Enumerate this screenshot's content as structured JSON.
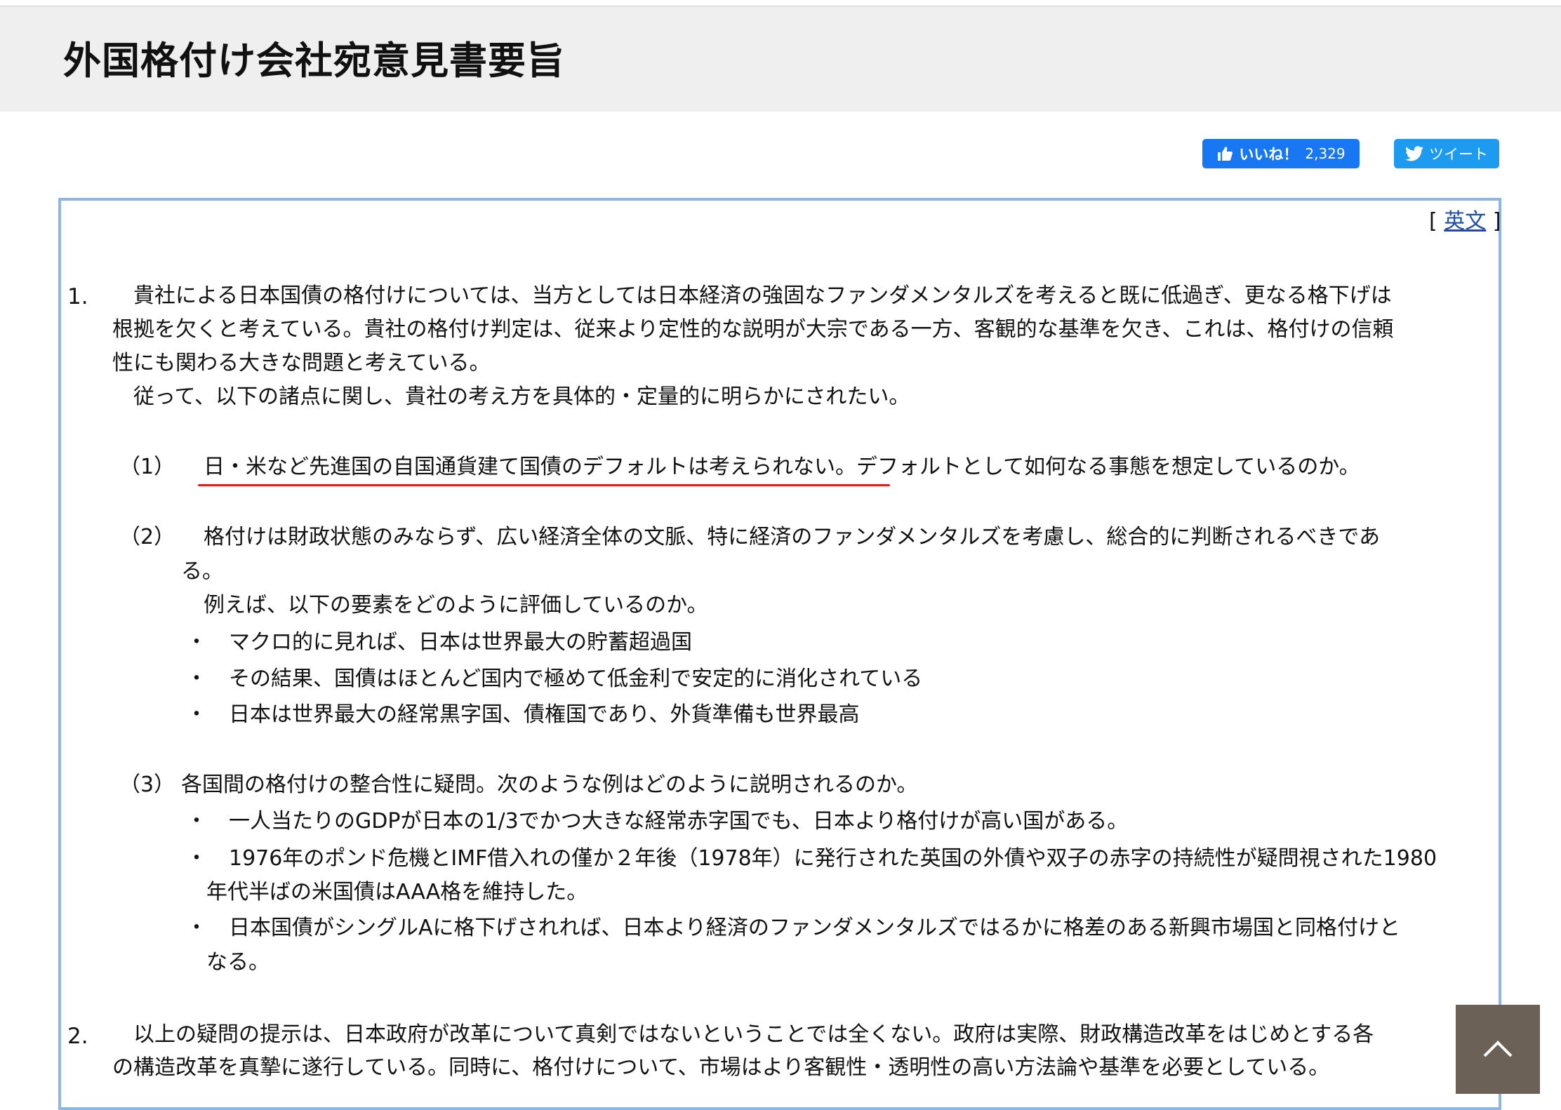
{
  "header": {
    "title": "外国格付け会社宛意見書要旨"
  },
  "social": {
    "like_label": "いいね！",
    "like_count": "2,329",
    "tweet_label": "ツイート"
  },
  "english_link": {
    "open": "[ ",
    "label": "英文",
    "close": " ]"
  },
  "section1": {
    "number": "1.",
    "lines": [
      "　貴社による日本国債の格付けについては、当方としては日本経済の強固なファンダメンタルズを考えると既に低過ぎ、更なる格下げは",
      "根拠を欠くと考えている。貴社の格付け判定は、従来より定性的な説明が大宗である一方、客観的な基準を欠き、これは、格付けの信頼",
      "性にも関わる大きな問題と考えている。",
      "　従って、以下の諸点に関し、貴社の考え方を具体的・定量的に明らかにされたい。"
    ]
  },
  "item1": {
    "marker": "（1）",
    "text": "日・米など先進国の自国通貨建て国債のデフォルトは考えられない。デフォルトとして如何なる事態を想定しているのか。"
  },
  "item2": {
    "marker": "（2）",
    "lines": [
      "格付けは財政状態のみならず、広い経済全体の文脈、特に経済のファンダメンタルズを考慮し、総合的に判断されるべきであ",
      "る。",
      "例えば、以下の要素をどのように評価しているのか。"
    ],
    "bullet": "・",
    "bullets": [
      "マクロ的に見れば、日本は世界最大の貯蓄超過国",
      "その結果、国債はほとんど国内で極めて低金利で安定的に消化されている",
      "日本は世界最大の経常黒字国、債権国であり、外貨準備も世界最高"
    ]
  },
  "item3": {
    "marker": "（3）",
    "text": "各国間の格付けの整合性に疑問。次のような例はどのように説明されるのか。",
    "bullet": "・",
    "bullets": [
      {
        "lines": [
          "一人当たりのGDPが日本の1/3でかつ大きな経常赤字国でも、日本より格付けが高い国がある。"
        ]
      },
      {
        "lines": [
          "1976年のポンド危機とIMF借入れの僅か２年後（1978年）に発行された英国の外債や双子の赤字の持続性が疑問視された1980",
          "年代半ばの米国債はAAA格を維持した。"
        ]
      },
      {
        "lines": [
          "日本国債がシングルAに格下げされれば、日本より経済のファンダメンタルズではるかに格差のある新興市場国と同格付けと",
          "なる。"
        ]
      }
    ]
  },
  "section2": {
    "number": "2.",
    "lines": [
      "　以上の疑問の提示は、日本政府が改革について真剣ではないということでは全くない。政府は実際、財政構造改革をはじめとする各",
      "の構造改革を真摯に遂行している。同時に、格付けについて、市場はより客観性・透明性の高い方法論や基準を必要としている。"
    ]
  }
}
